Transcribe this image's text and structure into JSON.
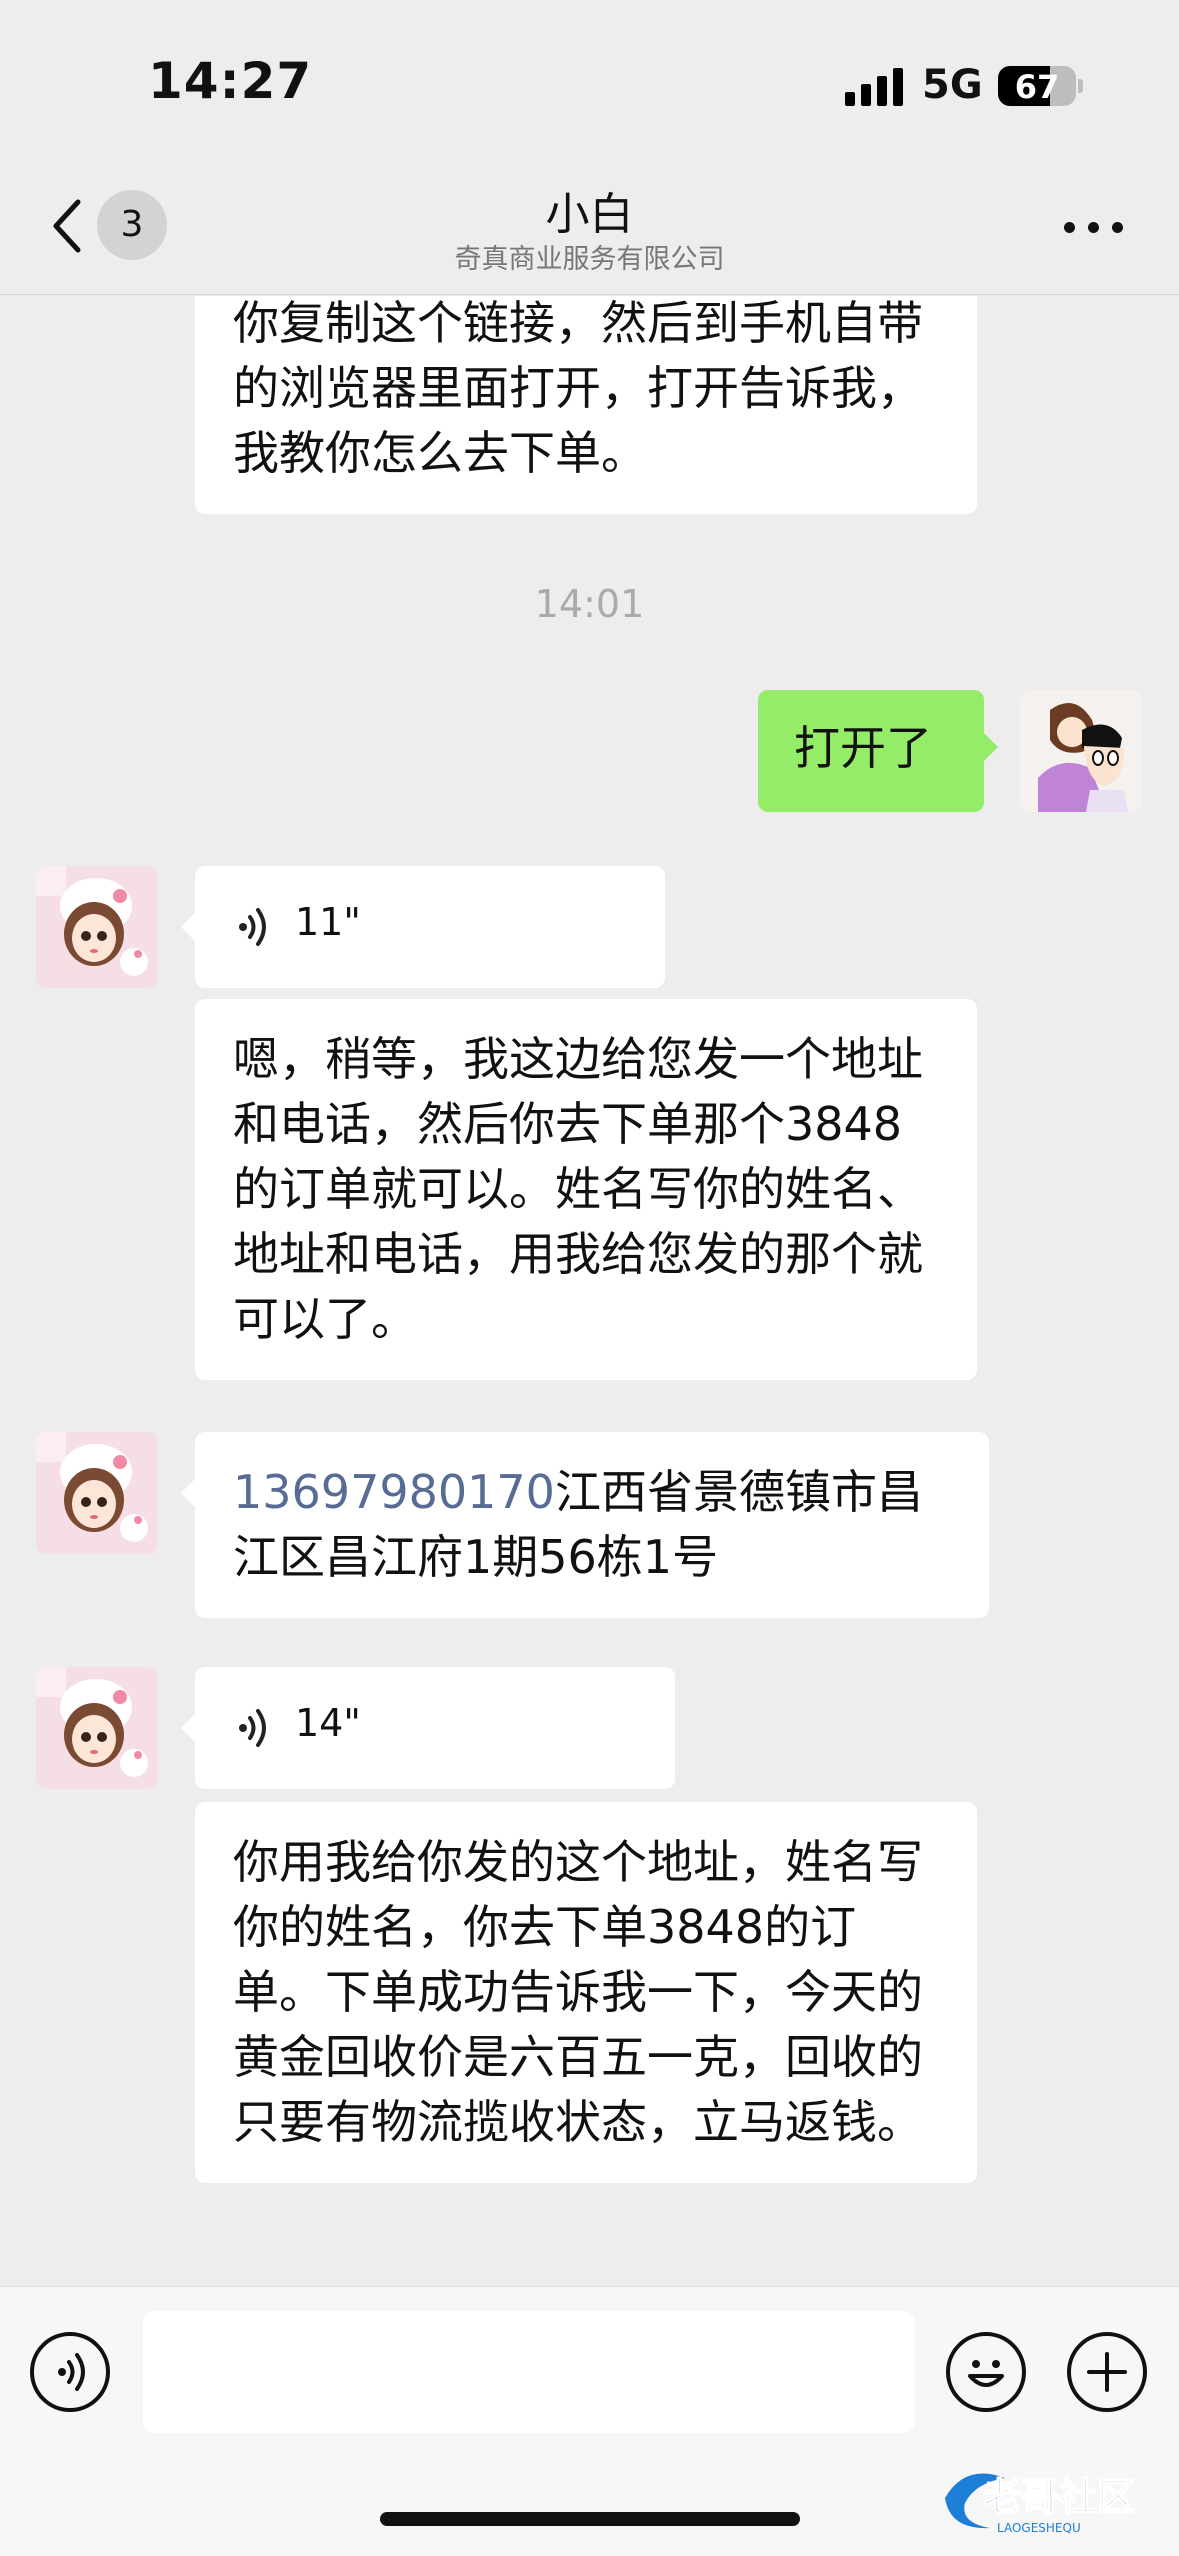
{
  "status_bar": {
    "time": "14:27",
    "network": "5G",
    "battery": "67",
    "battery_level": 0.67
  },
  "header": {
    "unread_count": "3",
    "title": "小白",
    "subtitle": "奇真商业服务有限公司"
  },
  "messages": [
    {
      "from": "contact",
      "type": "text",
      "text": "你复制这个链接，然后到手机自带的浏览器里面打开，打开告诉我，我教你怎么去下单。"
    },
    {
      "type": "timestamp",
      "text": "14:01"
    },
    {
      "from": "me",
      "type": "text",
      "text": "打开了"
    },
    {
      "from": "contact",
      "type": "voice",
      "duration": "11\""
    },
    {
      "from": "contact",
      "type": "text",
      "text": "嗯，稍等，我这边给您发一个地址和电话，然后你去下单那个3848的订单就可以。姓名写你的姓名、地址和电话，用我给您发的那个就可以了。"
    },
    {
      "from": "contact",
      "type": "text",
      "phone": "13697980170",
      "text": "江西省景德镇市昌江区昌江府1期56栋1号"
    },
    {
      "from": "contact",
      "type": "voice",
      "duration": "14\""
    },
    {
      "from": "contact",
      "type": "text",
      "text": "你用我给你发的这个地址，姓名写你的姓名，你去下单3848的订单。下单成功告诉我一下，今天的黄金回收价是六百五一克，回收的只要有物流揽收状态，立马返钱。"
    }
  ],
  "watermark": {
    "text": "老哥社区",
    "sub": "LAOGESHEQU"
  },
  "icons": {
    "back": "chevron-left-icon",
    "more": "more-dots-icon",
    "voice_toggle": "voice-input-icon",
    "emoji": "emoji-icon",
    "add": "plus-icon"
  },
  "colors": {
    "background": "#ededed",
    "sent_bubble": "#95ec69",
    "received_bubble": "#ffffff",
    "link": "#576b95"
  }
}
